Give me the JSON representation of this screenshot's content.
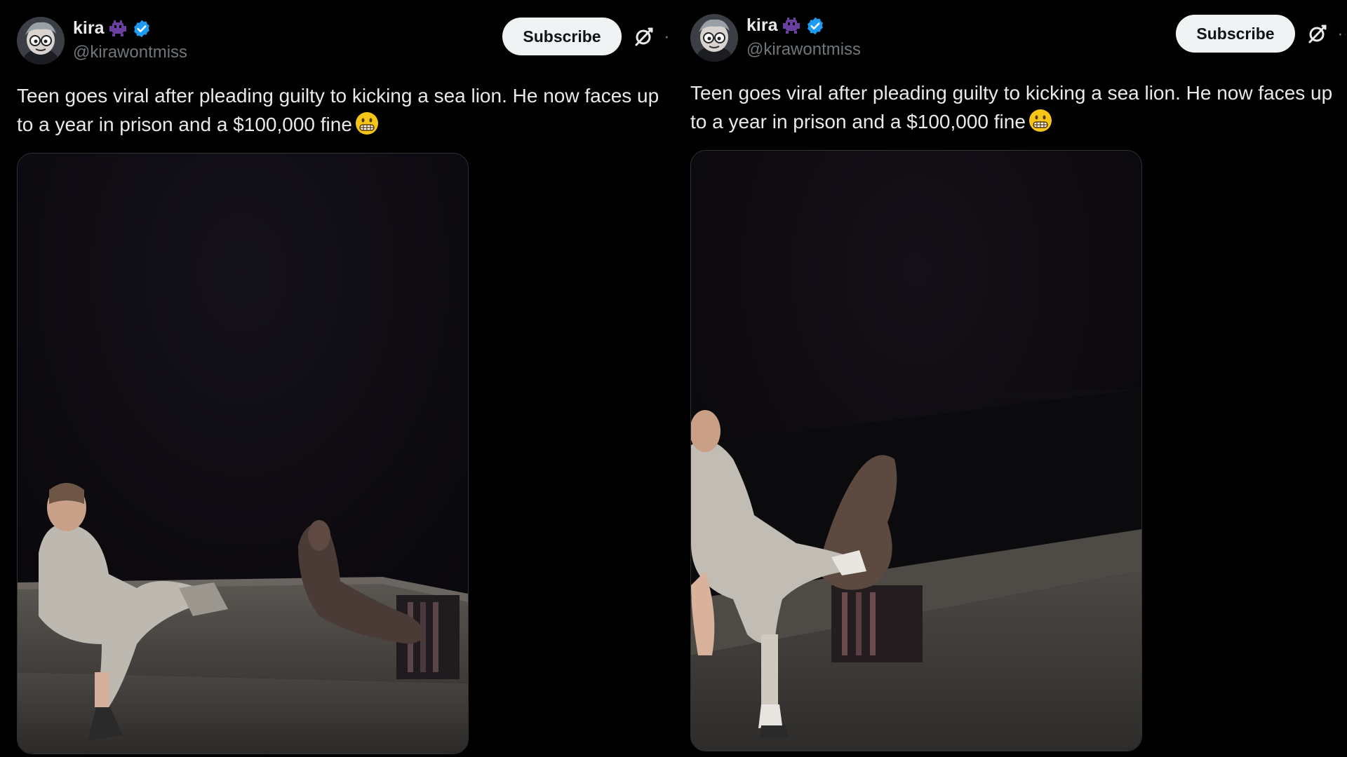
{
  "posts": [
    {
      "user": {
        "display_name": "kira",
        "handle": "@kirawontmiss",
        "avatar_icon": "cartoon-avatar-icon",
        "badge_icons": [
          "alien-monster-emoji-icon",
          "verified-badge-icon"
        ]
      },
      "subscribe_label": "Subscribe",
      "text": "Teen goes viral after pleading guilty to kicking a sea lion. He now faces up to a year in prison and a $100,000 fine",
      "emoji": "grimacing-face-emoji-icon",
      "media": {
        "type": "video-frame"
      }
    },
    {
      "user": {
        "display_name": "kira",
        "handle": "@kirawontmiss",
        "avatar_icon": "cartoon-avatar-icon",
        "badge_icons": [
          "alien-monster-emoji-icon",
          "verified-badge-icon"
        ]
      },
      "subscribe_label": "Subscribe",
      "text": "Teen goes viral after pleading guilty to kicking a sea lion. He now faces up to a year in prison and a $100,000 fine",
      "emoji": "grimacing-face-emoji-icon",
      "media": {
        "type": "video-frame"
      }
    }
  ],
  "colors": {
    "background": "#000000",
    "text_primary": "#e7e9ea",
    "text_secondary": "#71767b",
    "verified_blue": "#1d9bf0",
    "button_bg": "#eff3f4",
    "button_text": "#0f1419"
  }
}
